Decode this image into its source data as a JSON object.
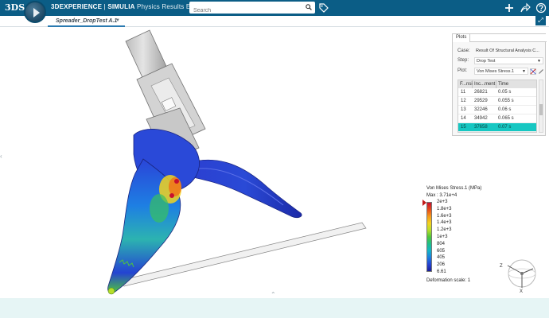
{
  "header": {
    "brand_logo": "3DS",
    "app_bold": "3DEXPERIENCE",
    "app_separator": " | ",
    "app_simulia": "SIMULIA",
    "app_light": " Physics Results Explorer",
    "search_placeholder": "Search",
    "icons": [
      "search-icon",
      "tag-icon",
      "plus-icon",
      "share-icon",
      "help-icon"
    ]
  },
  "tabs": {
    "active": "Spreader_DropTest A.1"
  },
  "plots_panel": {
    "tab_label": "Plots",
    "case_label": "Case:",
    "case_value": "Result Of Structural Analysis C...",
    "step_label": "Step:",
    "step_value": "Drop Test",
    "plot_label": "Plot:",
    "plot_value": "Von Mises Stress.1",
    "columns": [
      "F...nsi",
      "Inc...ment",
      "Time"
    ],
    "rows": [
      {
        "frame": "11",
        "increment": "26821",
        "time": "0.05 s"
      },
      {
        "frame": "12",
        "increment": "29529",
        "time": "0.055 s"
      },
      {
        "frame": "13",
        "increment": "32246",
        "time": "0.06 s"
      },
      {
        "frame": "14",
        "increment": "34942",
        "time": "0.065 s"
      },
      {
        "frame": "15",
        "increment": "37658",
        "time": "0.07 s"
      }
    ],
    "selected_frame": "15"
  },
  "legend": {
    "title": "Von Mises Stress.1 (MPa)",
    "max": "Max : 3.71e+4",
    "labels": [
      "2e+3",
      "1.8e+3",
      "1.6e+3",
      "1.4e+3",
      "1.2e+3",
      "1e+3",
      "804",
      "605",
      "405",
      "206",
      "6.61"
    ],
    "deformation": "Deformation scale: 1",
    "colors": [
      "#c8102e",
      "#e84a1a",
      "#f59a1a",
      "#f4d21e",
      "#b6de2a",
      "#4fc63a",
      "#1ebf8a",
      "#13b5c6",
      "#1b7fe0",
      "#2443d2",
      "#1b1f9a"
    ]
  },
  "compass": {
    "axis_z": "Z",
    "axis_x": "X"
  }
}
